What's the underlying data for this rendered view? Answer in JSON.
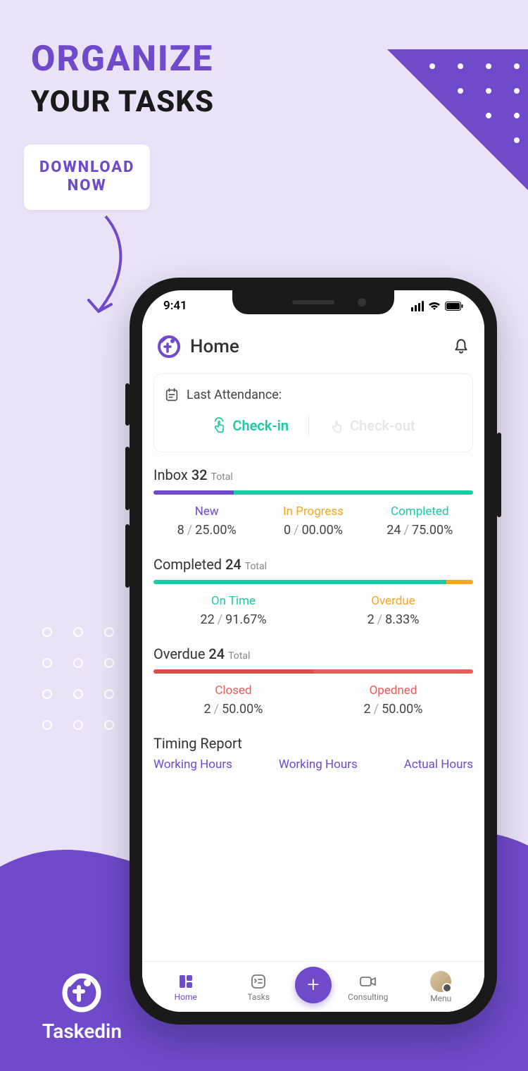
{
  "promo": {
    "title1": "ORGANIZE",
    "title2": "YOUR TASKS",
    "download_l1": "DOWNLOAD",
    "download_l2": "NOW",
    "brand": "Taskedin"
  },
  "status": {
    "time": "9:41"
  },
  "header": {
    "title": "Home"
  },
  "attendance": {
    "label": "Last Attendance:",
    "checkin": "Check-in",
    "checkout": "Check-out"
  },
  "inbox": {
    "title": "Inbox",
    "count": "32",
    "total_label": "Total",
    "cols": {
      "new_label": "New",
      "new_count": "8",
      "new_pct": "25.00%",
      "inprog_label": "In Progress",
      "inprog_count": "0",
      "inprog_pct": "00.00%",
      "comp_label": "Completed",
      "comp_count": "24",
      "comp_pct": "75.00%"
    }
  },
  "completed": {
    "title": "Completed",
    "count": "24",
    "total_label": "Total",
    "cols": {
      "ontime_label": "On Time",
      "ontime_count": "22",
      "ontime_pct": "91.67%",
      "overdue_label": "Overdue",
      "overdue_count": "2",
      "overdue_pct": "8.33%"
    }
  },
  "overdue": {
    "title": "Overdue",
    "count": "24",
    "total_label": "Total",
    "cols": {
      "closed_label": "Closed",
      "closed_count": "2",
      "closed_pct": "50.00%",
      "opened_label": "Opedned",
      "opened_count": "2",
      "opened_pct": "50.00%"
    }
  },
  "timing": {
    "title": "Timing Report",
    "c1": "Working Hours",
    "c2": "Working Hours",
    "c3": "Actual Hours"
  },
  "nav": {
    "home": "Home",
    "tasks": "Tasks",
    "consulting": "Consulting",
    "menu": "Menu"
  }
}
